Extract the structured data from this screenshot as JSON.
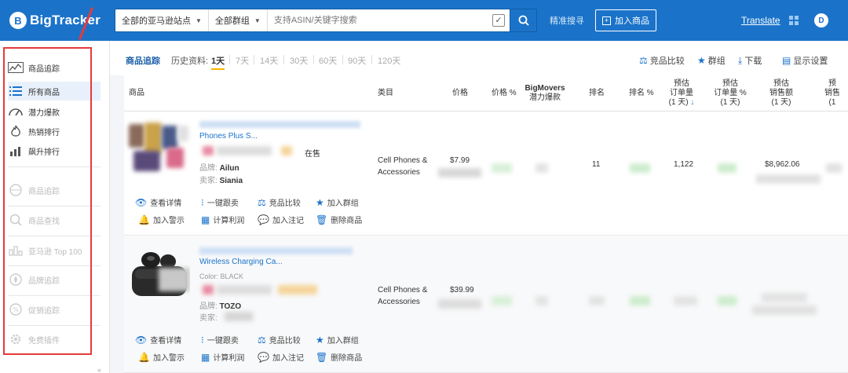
{
  "brand": {
    "name": "BigTracker",
    "mark": "B"
  },
  "topbar": {
    "marketplace_select": "全部的亚马逊站点",
    "group_select": "全部群组",
    "search_placeholder": "支持ASIN/关键字搜索",
    "check_mark": "✓",
    "quick_report": "精准搜寻",
    "add_product": "加入商品",
    "translate": "Translate",
    "avatar_letter": "D"
  },
  "sidebar": {
    "items": [
      {
        "label": "商品追踪",
        "icon": "chart-grid-icon",
        "state": "header"
      },
      {
        "label": "所有商品",
        "icon": "list-icon",
        "state": "active"
      },
      {
        "label": "潜力爆款",
        "icon": "gauge-icon",
        "state": "normal"
      },
      {
        "label": "热销排行",
        "icon": "fire-icon",
        "state": "normal"
      },
      {
        "label": "飙升排行",
        "icon": "rising-chart-icon",
        "state": "normal"
      },
      {
        "label": "商品追踪",
        "icon": "globe-icon",
        "state": "muted"
      },
      {
        "label": "商品查找",
        "icon": "magnifier-icon",
        "state": "muted"
      },
      {
        "label": "亚马逊 Top 100",
        "icon": "bar-chart-icon",
        "state": "muted"
      },
      {
        "label": "品牌追踪",
        "icon": "compass-icon",
        "state": "muted"
      },
      {
        "label": "促销追踪",
        "icon": "percent-icon",
        "state": "muted"
      },
      {
        "label": "免费插件",
        "icon": "gear-icon",
        "state": "muted"
      }
    ],
    "collapse_label": "«"
  },
  "tracking": {
    "title": "商品追踪",
    "history_label": "历史资料:",
    "options": [
      "1天",
      "7天",
      "14天",
      "30天",
      "60天",
      "90天",
      "120天"
    ],
    "selected": "1天",
    "tools": {
      "compare": "竞品比较",
      "group": "群组",
      "download": "下载",
      "display": "显示设置"
    }
  },
  "table": {
    "headers": {
      "product": "商品",
      "category": "类目",
      "price": "价格",
      "price_pct": "价格 %",
      "bigmovers": "BigMovers",
      "bigmovers_sub": "潜力爆款",
      "rank": "排名",
      "rank_pct": "排名 %",
      "est_orders_l1": "预估",
      "est_orders_l2": "订单量",
      "est_orders_l3": "(1 天)",
      "est_orders_pct_l1": "预估",
      "est_orders_pct_l2": "订单量 %",
      "est_orders_pct_l3": "(1 天)",
      "est_sales_l1": "预估",
      "est_sales_l2": "销售额",
      "est_sales_l3": "(1 天)",
      "est_sales_pct_l1": "预",
      "est_sales_pct_l2": "销售",
      "est_sales_pct_l3": "(1",
      "sort_arrow": "↓"
    },
    "actions": {
      "detail": "查看详情",
      "follow": "一键跟卖",
      "compare": "竞品比较",
      "add_group": "加入群组",
      "add_alert": "加入警示",
      "calc_profit": "计算利润",
      "add_note": "加入注记",
      "delete": "删除商品"
    },
    "rows": [
      {
        "title_line": "Phones Plus S...",
        "status": "在售",
        "brand_label": "品牌:",
        "brand": "Ailun",
        "seller_label": "卖家:",
        "seller": "Siania",
        "category": "Cell Phones & Accessories",
        "price": "$7.99",
        "rank": "11",
        "orders": "1,122",
        "sales": "$8,962.06"
      },
      {
        "title_line": "Wireless Charging Ca...",
        "color_line": "Color: BLACK",
        "brand_label": "品牌:",
        "brand": "TOZO",
        "seller_label": "卖家:",
        "category": "Cell Phones & Accessories",
        "price": "$39.99"
      }
    ]
  }
}
